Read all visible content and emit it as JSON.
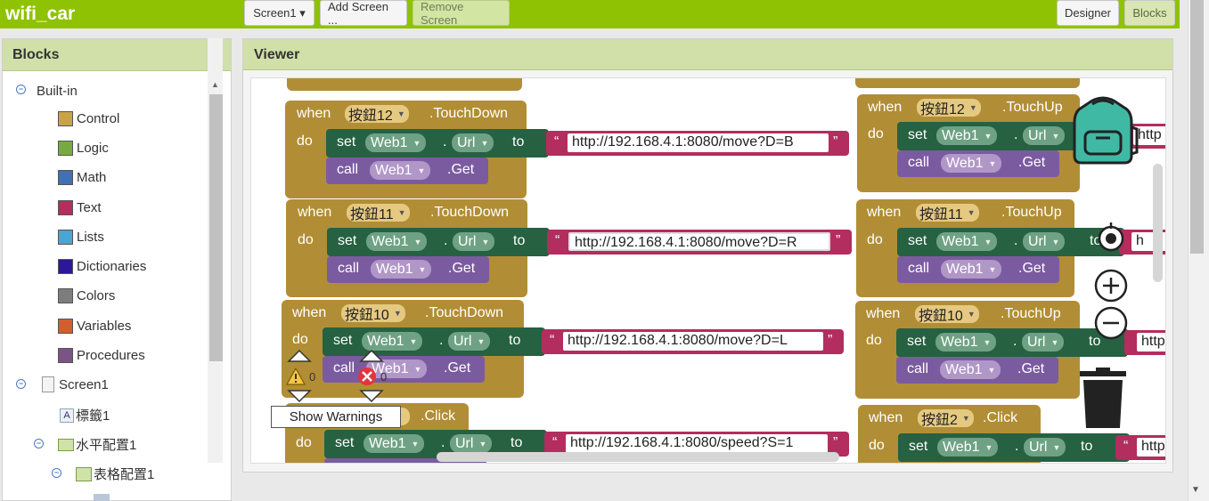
{
  "app": {
    "title": "wifi_car"
  },
  "toolbar": {
    "screen_select": "Screen1 ▾",
    "add_screen": "Add Screen ...",
    "remove_screen": "Remove Screen",
    "designer": "Designer",
    "blocks": "Blocks"
  },
  "blocks_panel": {
    "title": "Blocks",
    "builtin": "Built-in",
    "items": [
      {
        "label": "Control",
        "color": "#c9a349"
      },
      {
        "label": "Logic",
        "color": "#77ab41"
      },
      {
        "label": "Math",
        "color": "#3f71b5"
      },
      {
        "label": "Text",
        "color": "#b32d5e"
      },
      {
        "label": "Lists",
        "color": "#49a6d4"
      },
      {
        "label": "Dictionaries",
        "color": "#2d1799"
      },
      {
        "label": "Colors",
        "color": "#7d7d7d"
      },
      {
        "label": "Variables",
        "color": "#d05f2d"
      },
      {
        "label": "Procedures",
        "color": "#7c5385"
      }
    ],
    "screen": "Screen1",
    "components": [
      "標籤1",
      "水平配置1",
      "表格配置1"
    ]
  },
  "viewer": {
    "title": "Viewer",
    "kw": {
      "when": "when",
      "do": "do",
      "set": "set",
      "call": "call",
      "to": "to",
      "dot": ".",
      "url": "Url",
      "get": ".Get",
      "web1": "Web1",
      "open_q": "“",
      "close_q": "”"
    },
    "blocks": [
      {
        "button": "按鈕12",
        "event": ".TouchDown",
        "url": "http://192.168.4.1:8080/move?D=B"
      },
      {
        "button": "按鈕11",
        "event": ".TouchDown",
        "url": "http://192.168.4.1:8080/move?D=R"
      },
      {
        "button": "按鈕10",
        "event": ".TouchDown",
        "url": "http://192.168.4.1:8080/move?D=L"
      },
      {
        "button": "",
        "event": ".Click",
        "url": "http://192.168.4.1:8080/speed?S=1"
      },
      {
        "button": "按鈕12",
        "event": ".TouchUp",
        "url": "http"
      },
      {
        "button": "按鈕11",
        "event": ".TouchUp",
        "url": "h"
      },
      {
        "button": "按鈕10",
        "event": ".TouchUp",
        "url": "http"
      },
      {
        "button": "按鈕2",
        "event": ".Click",
        "url": "http"
      }
    ],
    "warnings_count": "0",
    "errors_count": "0",
    "show_warnings": "Show Warnings"
  }
}
